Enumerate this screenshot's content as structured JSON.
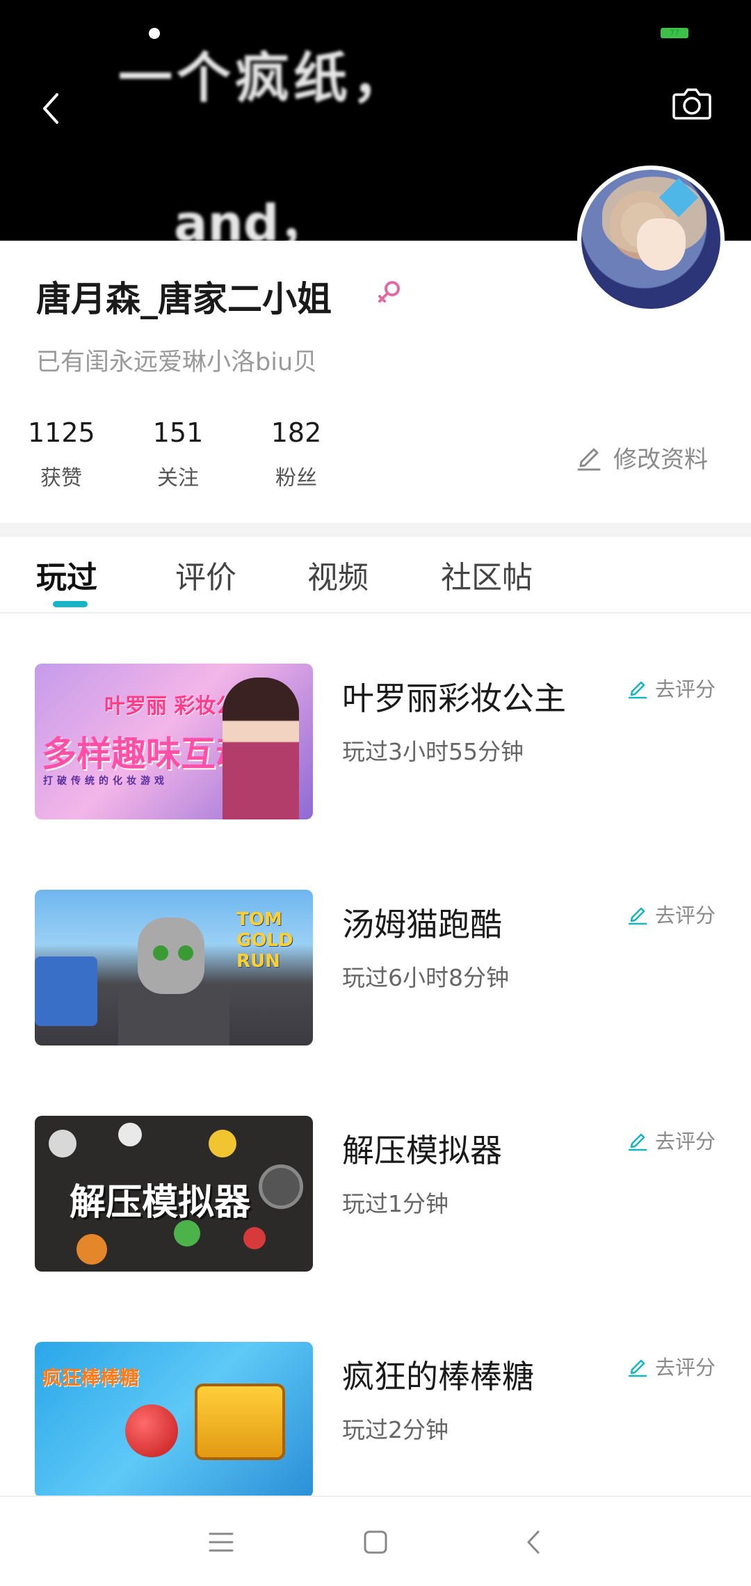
{
  "header": {
    "cover_text_line1": "一个疯纸，",
    "cover_text_line2": "and，",
    "battery_level": "77",
    "back_icon": "chevron-left-icon",
    "camera_icon": "camera-icon"
  },
  "profile": {
    "name": "唐月森_唐家二小姐",
    "gender_icon": "female-icon",
    "bio": "已有闺永远爱琳小洛biu贝",
    "stats": [
      {
        "value": "1125",
        "label": "获赞"
      },
      {
        "value": "151",
        "label": "关注"
      },
      {
        "value": "182",
        "label": "粉丝"
      }
    ],
    "edit_label": "修改资料"
  },
  "tabs": [
    {
      "label": "玩过",
      "active": true
    },
    {
      "label": "评价",
      "active": false
    },
    {
      "label": "视频",
      "active": false
    },
    {
      "label": "社区帖",
      "active": false
    }
  ],
  "games": [
    {
      "title": "叶罗丽彩妆公主",
      "playtime": "玩过3小时55分钟",
      "rate_label": "去评分",
      "thumb_text": "多样趣味互动",
      "thumb_logo": "叶罗丽 彩妆公主",
      "thumb_sub": "打破传统的化妆游戏"
    },
    {
      "title": "汤姆猫跑酷",
      "playtime": "玩过6小时8分钟",
      "rate_label": "去评分",
      "thumb_logo": "TOM GOLD RUN"
    },
    {
      "title": "解压模拟器",
      "playtime": "玩过1分钟",
      "rate_label": "去评分",
      "thumb_text": "解压模拟器"
    },
    {
      "title": "疯狂的棒棒糖",
      "playtime": "玩过2分钟",
      "rate_label": "去评分",
      "thumb_text": "疯狂棒棒糖"
    }
  ],
  "colors": {
    "accent": "#17b3c6",
    "gender_pink": "#e06aa5"
  },
  "nav": {
    "menu_icon": "menu-icon",
    "home_icon": "home-square-icon",
    "back_icon": "back-chevron-icon"
  }
}
